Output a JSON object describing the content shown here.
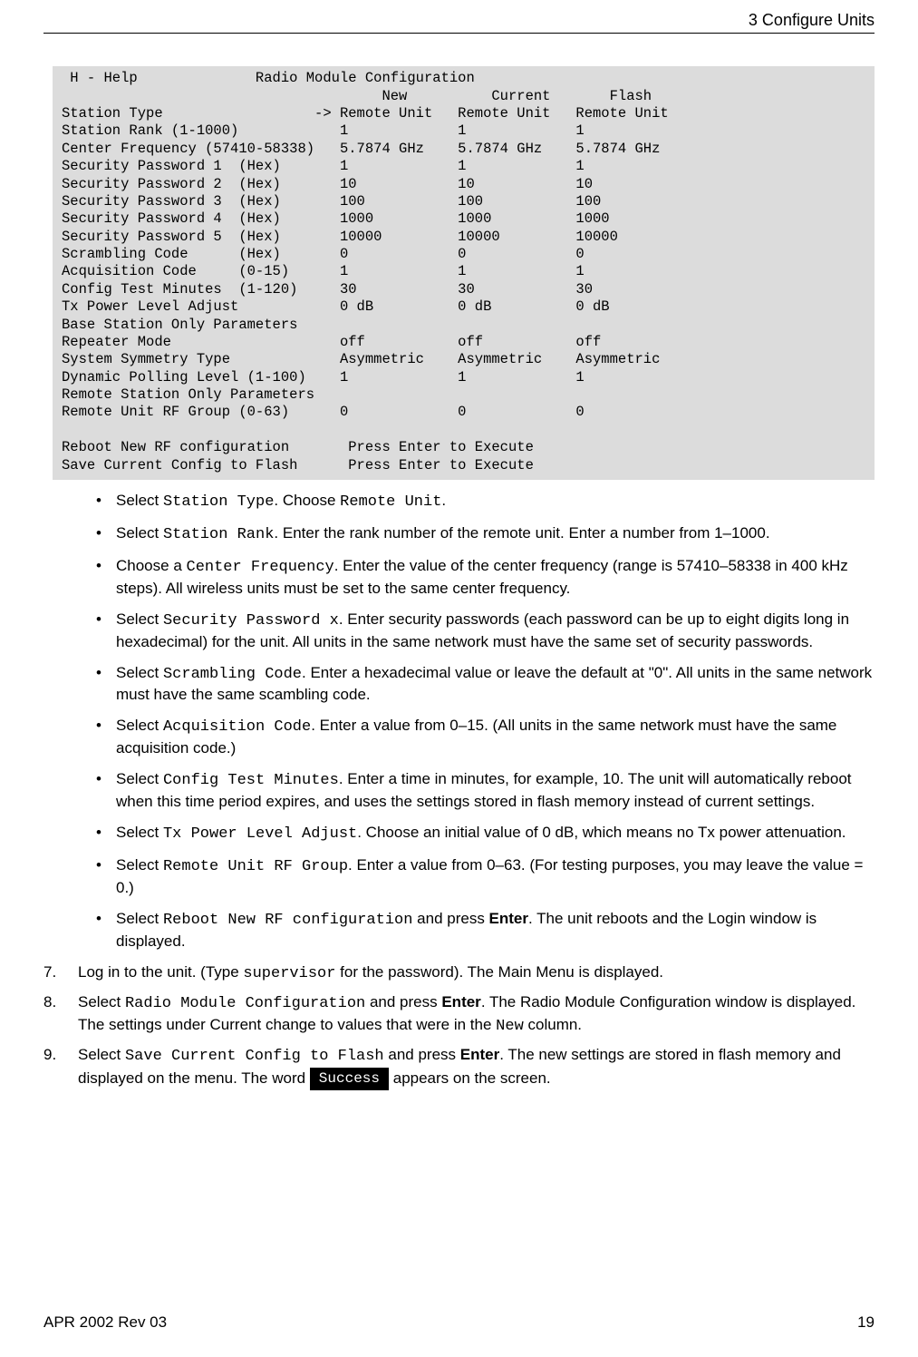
{
  "header": {
    "chapter_title": "3 Configure Units"
  },
  "terminal": {
    "help_label": "H - Help",
    "title": "Radio Module Configuration",
    "col_new": "New",
    "col_current": "Current",
    "col_flash": "Flash",
    "arrow": "->",
    "rows": [
      {
        "label": "Station Type",
        "marker": "-> ",
        "new": "Remote Unit",
        "current": "Remote Unit",
        "flash": "Remote Unit"
      },
      {
        "label": "Station Rank (1-1000)",
        "new": "1",
        "current": "1",
        "flash": "1"
      },
      {
        "label": "Center Frequency (57410-58338)",
        "new": "5.7874 GHz",
        "current": "5.7874 GHz",
        "flash": "5.7874 GHz"
      },
      {
        "label": "Security Password 1  (Hex)",
        "new": "1",
        "current": "1",
        "flash": "1"
      },
      {
        "label": "Security Password 2  (Hex)",
        "new": "10",
        "current": "10",
        "flash": "10"
      },
      {
        "label": "Security Password 3  (Hex)",
        "new": "100",
        "current": "100",
        "flash": "100"
      },
      {
        "label": "Security Password 4  (Hex)",
        "new": "1000",
        "current": "1000",
        "flash": "1000"
      },
      {
        "label": "Security Password 5  (Hex)",
        "new": "10000",
        "current": "10000",
        "flash": "10000"
      },
      {
        "label": "Scrambling Code      (Hex)",
        "new": "0",
        "current": "0",
        "flash": "0"
      },
      {
        "label": "Acquisition Code     (0-15)",
        "new": "1",
        "current": "1",
        "flash": "1"
      },
      {
        "label": "Config Test Minutes  (1-120)",
        "new": "30",
        "current": "30",
        "flash": "30"
      },
      {
        "label": "Tx Power Level Adjust",
        "new": "0 dB",
        "current": "0 dB",
        "flash": "0 dB"
      }
    ],
    "base_header": "Base Station Only Parameters",
    "rows2": [
      {
        "label": "Repeater Mode",
        "new": "off",
        "current": "off",
        "flash": "off"
      },
      {
        "label": "System Symmetry Type",
        "new": "Asymmetric",
        "current": "Asymmetric",
        "flash": "Asymmetric"
      },
      {
        "label": "Dynamic Polling Level (1-100)",
        "new": "1",
        "current": "1",
        "flash": "1"
      }
    ],
    "remote_header": "Remote Station Only Parameters",
    "rows3": [
      {
        "label": "Remote Unit RF Group (0-63)",
        "new": "0",
        "current": "0",
        "flash": "0"
      }
    ],
    "reboot_line": "Reboot New RF configuration       Press Enter to Execute",
    "save_line": "Save Current Config to Flash      Press Enter to Execute"
  },
  "bullets": [
    {
      "pre": "Select ",
      "code": "Station Type",
      "post": ". Choose ",
      "code2": "Remote Unit",
      "post2": "."
    },
    {
      "pre": "Select ",
      "code": "Station Rank",
      "post": ". Enter the rank number of the remote unit. Enter a number from 1–1000."
    },
    {
      "pre": "Choose a ",
      "code": "Center Frequency",
      "post": ". Enter the value of the center frequency (range is 57410–58338 in 400 kHz steps). All wireless units must be set to the same center frequency."
    },
    {
      "pre": "Select ",
      "code": "Security Password x",
      "post": ". Enter security passwords (each password can be up to eight digits long in hexadecimal) for the unit. All units in the same network must have the same set of security passwords."
    },
    {
      "pre": "Select ",
      "code": "Scrambling Code",
      "post": ". Enter a hexadecimal value or leave the default at \"0\". All units in the same network must have the same scambling code."
    },
    {
      "pre": "Select ",
      "code": "Acquisition Code",
      "post": ". Enter a value from 0–15. (All units in the same network must have the same acquisition code.)"
    },
    {
      "pre": "Select ",
      "code": "Config Test Minutes",
      "post": ". Enter a time in minutes, for example, 10. The unit will automat­ically reboot when this time period expires, and uses the settings stored in flash memory instead of current settings."
    },
    {
      "pre": "Select ",
      "code": "Tx Power Level Adjust",
      "post": ". Choose an initial value of 0 dB, which means no Tx power attenuation."
    },
    {
      "pre": "Select ",
      "code": "Remote Unit RF Group",
      "post": ". Enter a value from 0–63. (For testing purposes, you may leave the value = 0.)"
    },
    {
      "pre": "Select ",
      "code": "Reboot New RF configuration",
      "post": " and press ",
      "bold": "Enter",
      "post2": ". The unit reboots and the Login window is displayed."
    }
  ],
  "steps": [
    {
      "num": "7.",
      "pre": "Log in to the unit. (Type ",
      "code": "supervisor",
      "post": " for the password). The Main Menu is displayed."
    },
    {
      "num": "8.",
      "pre": "Select ",
      "code": "Radio Module Configuration",
      "post": " and press ",
      "bold": "Enter",
      "post2": ". The Radio Module Configuration window is displayed. The settings under Current change to values that were in the ",
      "code2": "New",
      "post3": " column."
    },
    {
      "num": "9.",
      "pre": "Select ",
      "code": "Save Current Config to Flash",
      "post": " and press ",
      "bold": "Enter",
      "post2": ". The new settings are stored in flash memory and displayed on the menu. The word ",
      "badge": "Success",
      "post3": " appears on the screen."
    }
  ],
  "footer": {
    "rev": "APR 2002 Rev 03",
    "page": "19"
  }
}
